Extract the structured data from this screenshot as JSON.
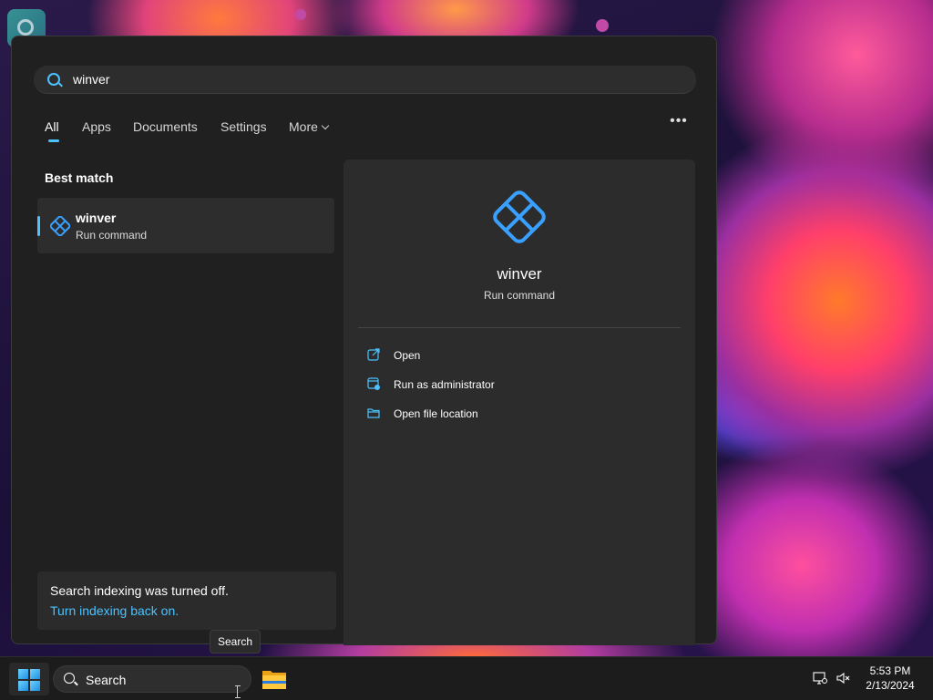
{
  "search": {
    "query": "winver"
  },
  "tabs": [
    {
      "label": "All"
    },
    {
      "label": "Apps"
    },
    {
      "label": "Documents"
    },
    {
      "label": "Settings"
    },
    {
      "label": "More"
    }
  ],
  "best_match": {
    "heading": "Best match",
    "name": "winver",
    "type": "Run command"
  },
  "details": {
    "name": "winver",
    "type": "Run command",
    "actions": [
      {
        "label": "Open",
        "icon": "open-external-icon"
      },
      {
        "label": "Run as administrator",
        "icon": "shield-admin-icon"
      },
      {
        "label": "Open file location",
        "icon": "folder-icon"
      }
    ]
  },
  "indexing": {
    "message": "Search indexing was turned off.",
    "link": "Turn indexing back on."
  },
  "tooltip": "Search",
  "taskbar": {
    "search_label": "Search",
    "time": "5:53 PM",
    "date": "2/13/2024"
  },
  "colors": {
    "accent": "#4cc2ff",
    "panel": "#202020",
    "detail_panel": "#2c2c2c"
  }
}
